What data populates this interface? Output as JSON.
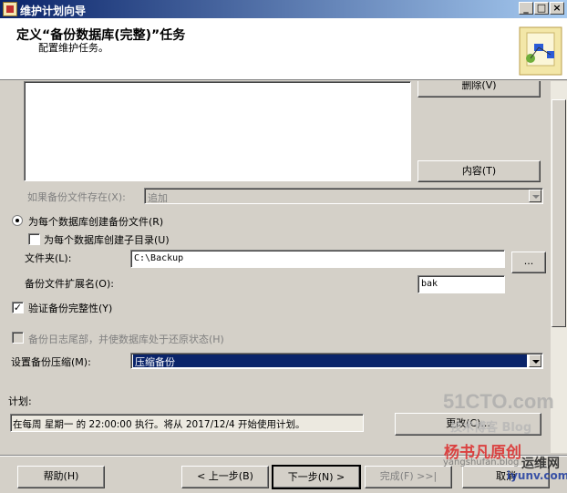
{
  "window": {
    "title": "维护计划向导",
    "minimize": "_",
    "maximize": "□",
    "close": "×"
  },
  "header": {
    "title": "定义“备份数据库(完整)”任务",
    "subtitle": "配置维护任务。"
  },
  "buttons": {
    "delete": "删除(V)",
    "contents": "内容(T)",
    "browse": "...",
    "change": "更改(C)..."
  },
  "form": {
    "if_exists_label": "如果备份文件存在(X):",
    "if_exists_value": "追加",
    "create_per_db_label": "为每个数据库创建备份文件(R)",
    "create_subdir_label": "为每个数据库创建子目录(U)",
    "folder_label": "文件夹(L):",
    "folder_value": "C:\\Backup",
    "ext_label": "备份文件扩展名(O):",
    "ext_value": "bak",
    "verify_label": "验证备份完整性(Y)",
    "verify_checked": "✓",
    "tail_log_label": "备份日志尾部，并使数据库处于还原状态(H)",
    "compression_label": "设置备份压缩(M):",
    "compression_value": "压缩备份"
  },
  "schedule": {
    "label": "计划:",
    "text": "在每周 星期一 的 22:00:00 执行。将从 2017/12/4 开始使用计划。"
  },
  "nav": {
    "help": "帮助(H)",
    "back": "< 上一步(B)",
    "next": "下一步(N) >",
    "finish": "完成(F) >>|",
    "cancel": "取消"
  },
  "watermarks": {
    "site": "51CTO.com",
    "blog": "技术博客  Blog",
    "author": "杨书凡原创",
    "author_url": "yangshufan.blog",
    "yunwei": "运维网",
    "yunwei_url": "iyunv.com"
  },
  "colors": {
    "face": "#d4d0c8",
    "selection": "#0a246a",
    "title_start": "#0a246a"
  }
}
